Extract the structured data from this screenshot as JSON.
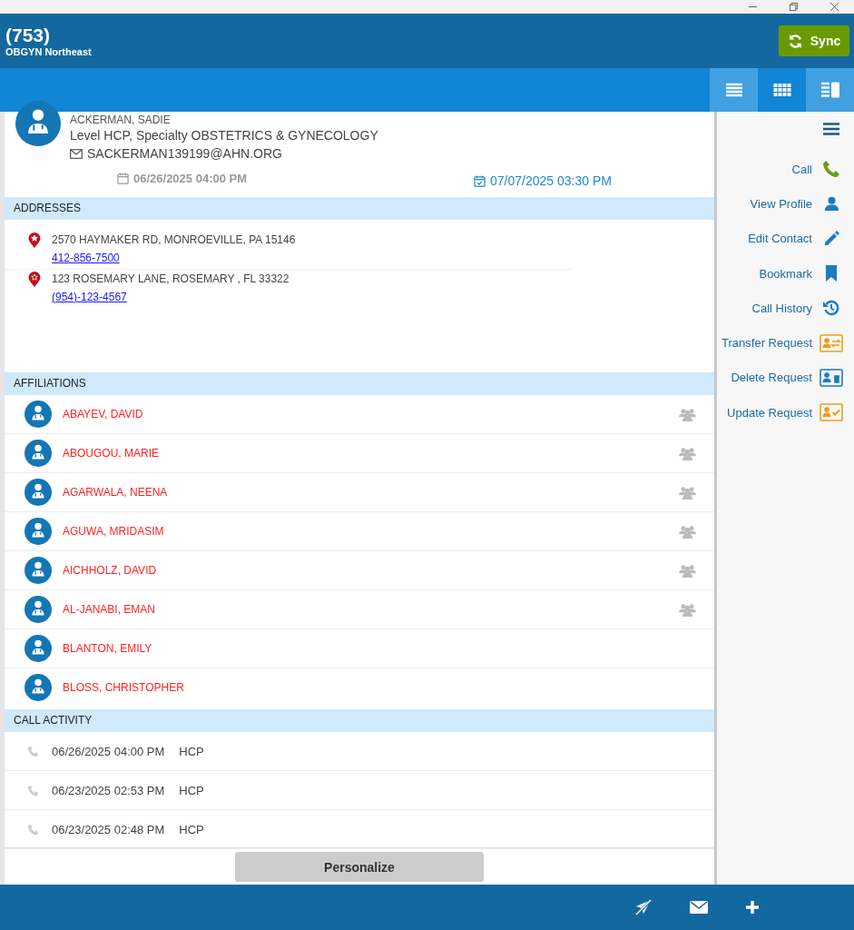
{
  "header": {
    "title": "(753)",
    "subtitle": "OBGYN Northeast",
    "sync_label": "Sync"
  },
  "view_toggles": [
    {
      "kind": "list",
      "highlighted": true
    },
    {
      "kind": "grid",
      "highlighted": false
    },
    {
      "kind": "split",
      "highlighted": true
    }
  ],
  "profile": {
    "name": "ACKERMAN, SADIE",
    "details": "Level HCP, Specialty OBSTETRICS & GYNECOLOGY",
    "email": "SACKERMAN139199@AHN.ORG"
  },
  "dates": [
    {
      "kind": "last",
      "text": "06/26/2025 04:00 PM"
    },
    {
      "kind": "next",
      "text": "07/07/2025 03:30 PM"
    }
  ],
  "addresses": {
    "title": "ADDRESSES",
    "items": [
      {
        "primary": true,
        "address": "2570 HAYMAKER RD, MONROEVILLE, PA 15146",
        "phone": "412-856-7500"
      },
      {
        "primary": false,
        "address": "123 ROSEMARY LANE, ROSEMARY , FL 33322",
        "phone": "(954)-123-4567"
      }
    ]
  },
  "affiliations": {
    "title": "AFFILIATIONS",
    "items": [
      {
        "name": "ABAYEV, DAVID",
        "group": true
      },
      {
        "name": "ABOUGOU, MARIE",
        "group": true
      },
      {
        "name": "AGARWALA, NEENA",
        "group": true
      },
      {
        "name": "AGUWA, MRIDASIM",
        "group": true
      },
      {
        "name": "AICHHOLZ, DAVID",
        "group": true
      },
      {
        "name": "AL-JANABI, EMAN",
        "group": true
      },
      {
        "name": "BLANTON, EMILY",
        "group": false
      },
      {
        "name": "BLOSS, CHRISTOPHER",
        "group": false
      }
    ]
  },
  "call_activity": {
    "title": "CALL ACTIVITY",
    "items": [
      {
        "time": "06/26/2025 04:00 PM",
        "level": "HCP"
      },
      {
        "time": "06/23/2025 02:53 PM",
        "level": "HCP"
      },
      {
        "time": "06/23/2025 02:48 PM",
        "level": "HCP"
      }
    ]
  },
  "personalize_label": "Personalize",
  "actions": [
    {
      "kind": "call",
      "label": "Call"
    },
    {
      "kind": "profile",
      "label": "View Profile"
    },
    {
      "kind": "edit",
      "label": "Edit Contact"
    },
    {
      "kind": "bookmark",
      "label": "Bookmark"
    },
    {
      "kind": "history",
      "label": "Call History"
    },
    {
      "kind": "transfer",
      "label": "Transfer Request"
    },
    {
      "kind": "delete",
      "label": "Delete Request"
    },
    {
      "kind": "update",
      "label": "Update Request"
    }
  ],
  "footer_actions": [
    {
      "kind": "no-send"
    },
    {
      "kind": "mail"
    },
    {
      "kind": "add"
    }
  ]
}
